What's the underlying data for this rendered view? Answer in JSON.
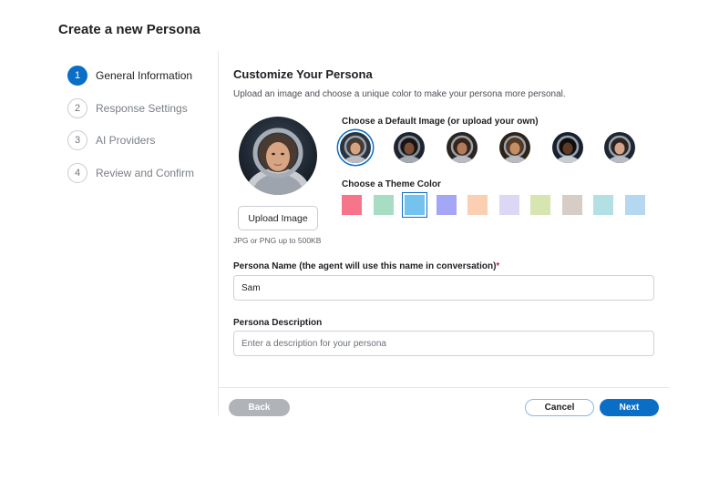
{
  "page": {
    "title": "Create a new Persona"
  },
  "steps": [
    {
      "number": "1",
      "label": "General Information",
      "active": true
    },
    {
      "number": "2",
      "label": "Response Settings",
      "active": false
    },
    {
      "number": "3",
      "label": "AI Providers",
      "active": false
    },
    {
      "number": "4",
      "label": "Review and Confirm",
      "active": false
    }
  ],
  "customize": {
    "title": "Customize Your Persona",
    "subtitle": "Upload an image and choose a unique color to make your persona more personal.",
    "upload_button": "Upload Image",
    "upload_hint": "JPG or PNG up to 500KB",
    "default_image_heading": "Choose a Default Image (or upload your own)",
    "selected_image_index": 0,
    "theme_color_heading": "Choose a Theme Color",
    "theme_colors": [
      "#f7758a",
      "#a7dcc5",
      "#74c2ee",
      "#a4a6f6",
      "#fbcfb2",
      "#dbd7f5",
      "#d7e5b1",
      "#d8ccc6",
      "#b3e0e2",
      "#b4d8f0"
    ],
    "selected_color_index": 2
  },
  "form": {
    "name_label": "Persona Name (the agent will use this name in conversation)",
    "name_required_mark": "*",
    "name_value": "Sam",
    "description_label": "Persona Description",
    "description_placeholder": "Enter a description for your persona"
  },
  "footer": {
    "back_label": "Back",
    "cancel_label": "Cancel",
    "next_label": "Next"
  },
  "accent_color": "#0b6ec6"
}
